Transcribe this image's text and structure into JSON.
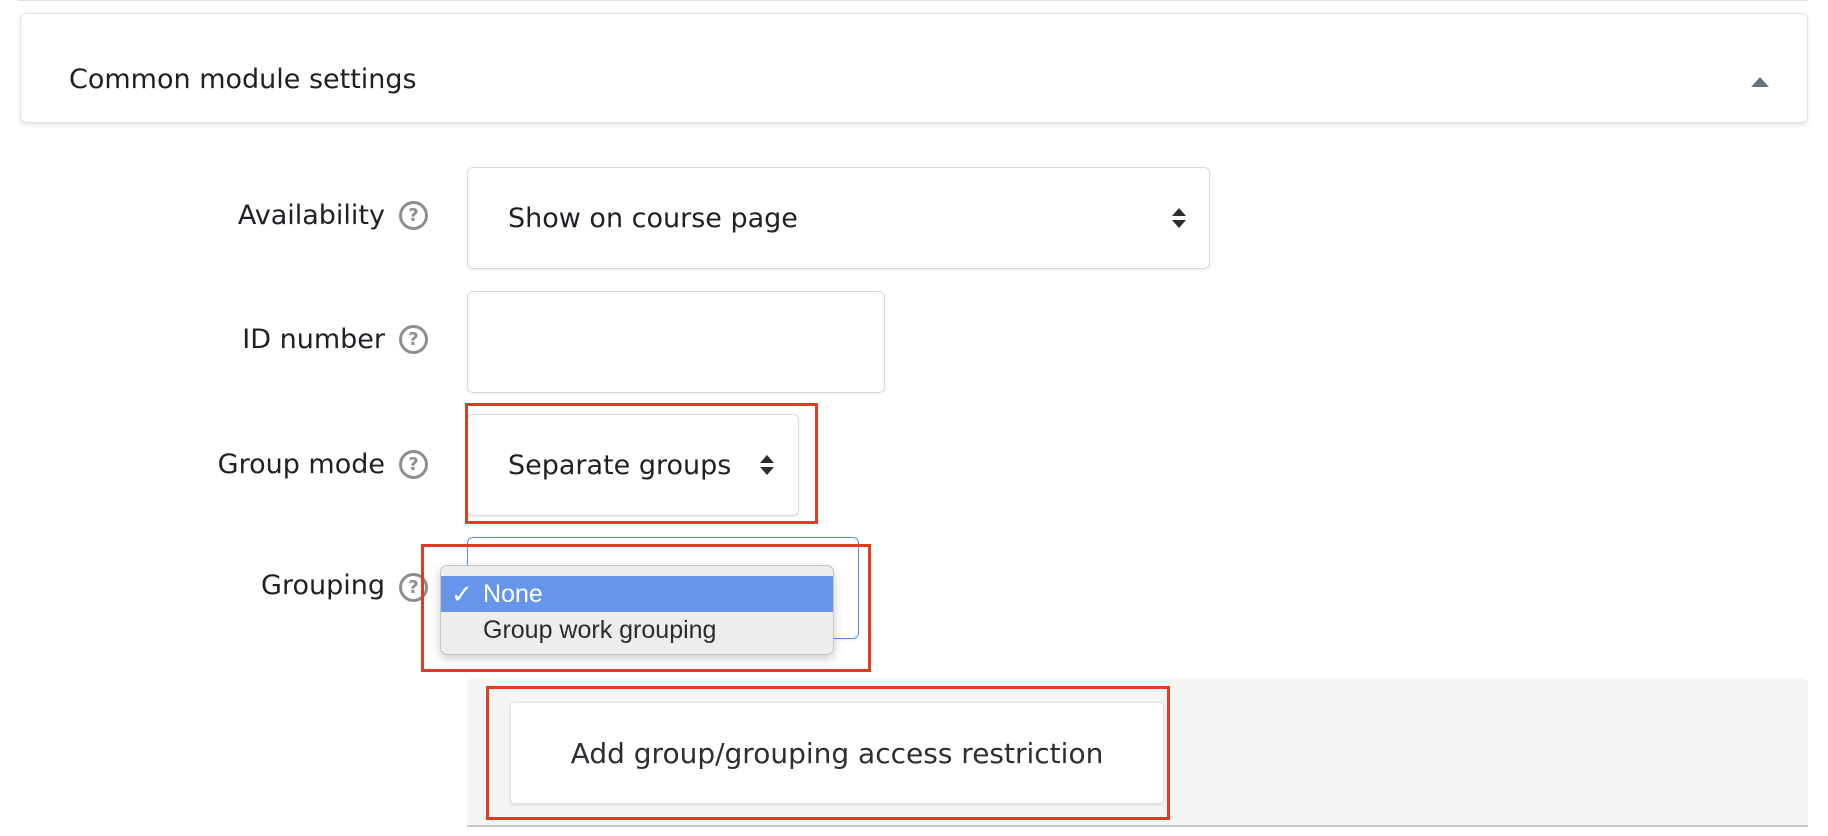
{
  "section": {
    "title": "Common module settings",
    "toggle_icon": "caret-up-icon"
  },
  "fields": {
    "availability": {
      "label": "Availability",
      "value": "Show on course page",
      "help_icon": "?"
    },
    "id_number": {
      "label": "ID number",
      "value": "",
      "help_icon": "?"
    },
    "group_mode": {
      "label": "Group mode",
      "value": "Separate groups",
      "help_icon": "?"
    },
    "grouping": {
      "label": "Grouping",
      "help_icon": "?",
      "options": [
        {
          "label": "None",
          "selected": true,
          "check": "✓"
        },
        {
          "label": "Group work grouping",
          "selected": false
        }
      ]
    }
  },
  "restriction": {
    "button_label": "Add group/grouping access restriction"
  },
  "colors": {
    "highlight": "#e03c23",
    "dropdown_selected": "#6795ec",
    "focus_border": "#5b8ef5"
  }
}
